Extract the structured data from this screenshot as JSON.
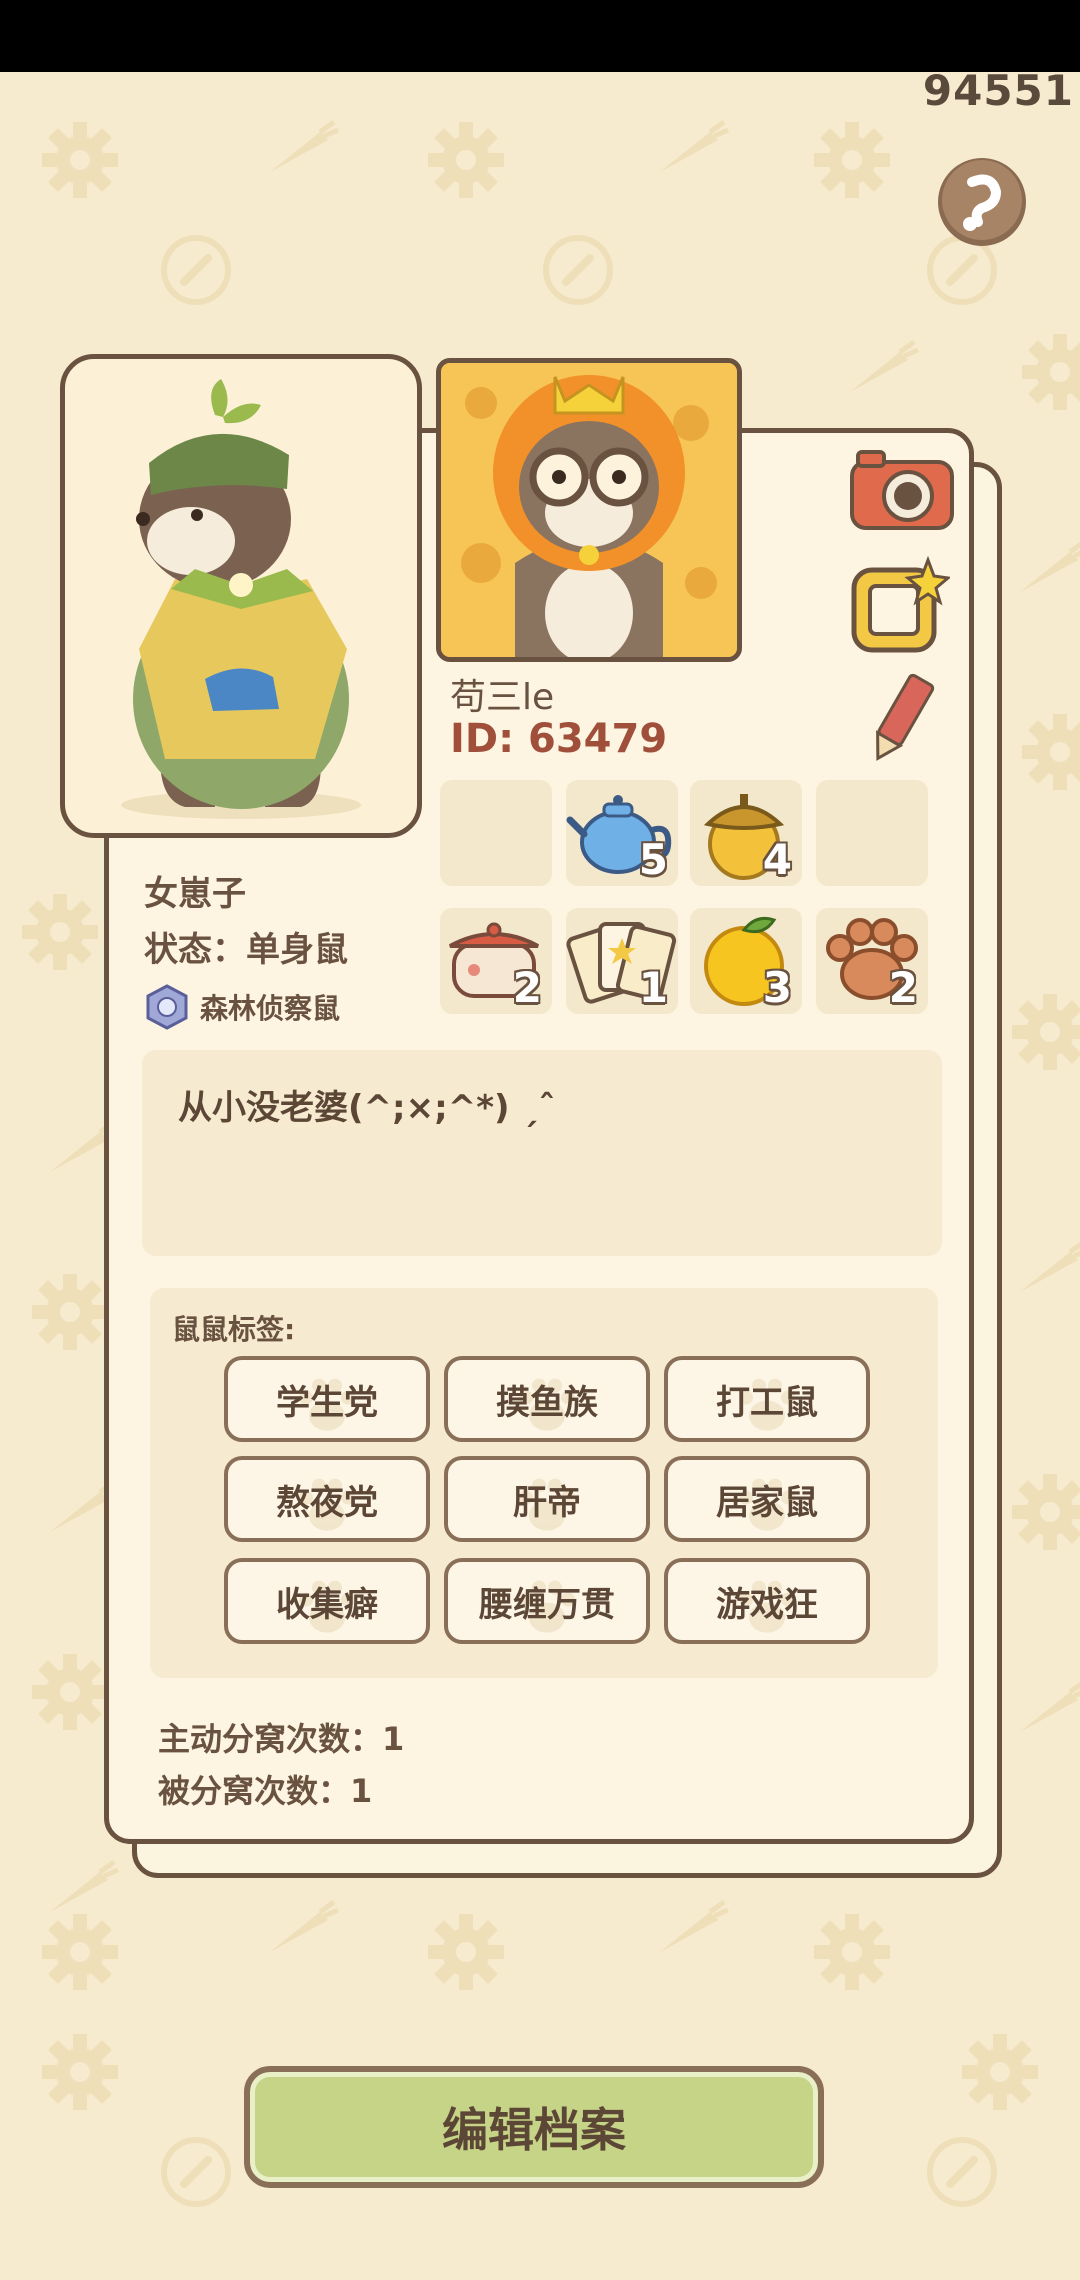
{
  "header": {
    "coin_count": "94551",
    "help_icon": "help-arrow-icon"
  },
  "profile": {
    "nickname": "苟三le",
    "id_text": "ID: 63479",
    "gender_title": "女崽子",
    "status_text": "状态：单身鼠",
    "title_badge": "森林侦察鼠",
    "bio": "从小没老婆(^;×;^*) ˏˆ"
  },
  "actions": {
    "camera": "camera-icon",
    "frame": "frame-icon",
    "edit": "pencil-icon"
  },
  "items": [
    {
      "icon": "empty-slot",
      "count": ""
    },
    {
      "icon": "teapot-icon",
      "count": "5"
    },
    {
      "icon": "acorn-icon",
      "count": "4"
    },
    {
      "icon": "empty-slot",
      "count": ""
    },
    {
      "icon": "pot-icon",
      "count": "2"
    },
    {
      "icon": "cards-icon",
      "count": "1"
    },
    {
      "icon": "orange-icon",
      "count": "3"
    },
    {
      "icon": "paw-icon",
      "count": "2"
    }
  ],
  "tags": {
    "title": "鼠鼠标签:",
    "items": [
      "学生党",
      "摸鱼族",
      "打工鼠",
      "熬夜党",
      "肝帝",
      "居家鼠",
      "收集癖",
      "腰缠万贯",
      "游戏狂"
    ]
  },
  "stats": {
    "active_split": "主动分窝次数：1",
    "passive_split": "被分窝次数：1"
  },
  "footer": {
    "edit_button": "编辑档案"
  },
  "colors": {
    "background": "#f6ebcf",
    "border": "#6a5240",
    "id_color": "#a0503a",
    "button_green": "#c5d487"
  }
}
